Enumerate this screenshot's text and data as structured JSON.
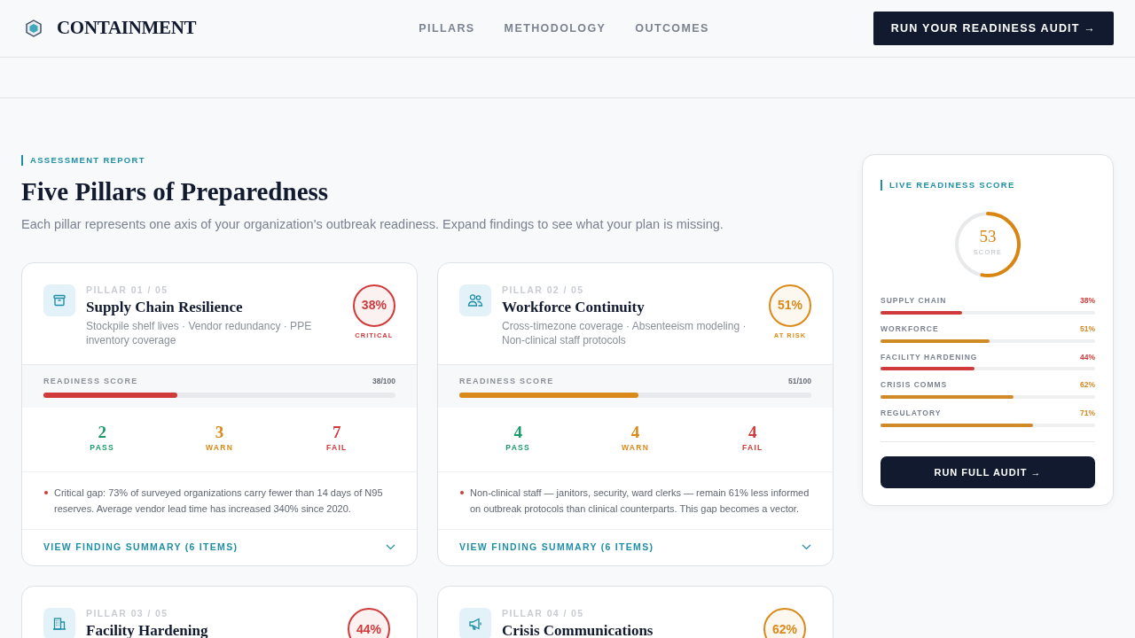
{
  "brand": {
    "name": "CONTAINMENT"
  },
  "nav": [
    {
      "label": "PILLARS"
    },
    {
      "label": "METHODOLOGY"
    },
    {
      "label": "OUTCOMES"
    }
  ],
  "cta": "RUN YOUR READINESS AUDIT →",
  "eyebrow": "ASSESSMENT REPORT",
  "title": "Five Pillars of Preparedness",
  "intro": "Each pillar represents one axis of your organization's outbreak readiness. Expand findings to see what your plan is missing.",
  "pillars": [
    {
      "number": "PILLAR 01 / 05",
      "title": "Supply Chain Resilience",
      "subtitle": "Stockpile shelf lives · Vendor redundancy · PPE inventory coverage",
      "percent": "38%",
      "color": "#d03a3a",
      "status_label": "CRITICAL",
      "score_label": "READINESS SCORE",
      "score_text": "38/100",
      "level": 0.38,
      "stats": [
        {
          "kind": "pass",
          "value": "2",
          "label": "PASS"
        },
        {
          "kind": "warn",
          "value": "3",
          "label": "WARN"
        },
        {
          "kind": "fail",
          "value": "7",
          "label": "FAIL"
        }
      ],
      "finding": "Critical gap: 73% of surveyed organizations carry fewer than 14 days of N95 reserves. Average vendor lead time has increased 340% since 2020.",
      "summary_link": "VIEW FINDING SUMMARY (6 ITEMS)"
    },
    {
      "number": "PILLAR 02 / 05",
      "title": "Workforce Continuity",
      "subtitle": "Cross-timezone coverage · Absenteeism modeling · Non-clinical staff protocols",
      "percent": "51%",
      "color": "#d98a1a",
      "status_label": "AT RISK",
      "score_label": "READINESS SCORE",
      "score_text": "51/100",
      "level": 0.51,
      "stats": [
        {
          "kind": "pass",
          "value": "4",
          "label": "PASS"
        },
        {
          "kind": "warn",
          "value": "4",
          "label": "WARN"
        },
        {
          "kind": "fail",
          "value": "4",
          "label": "FAIL"
        }
      ],
      "finding": "Non-clinical staff — janitors, security, ward clerks — remain 61% less informed on outbreak protocols than clinical counterparts. This gap becomes a vector.",
      "summary_link": "VIEW FINDING SUMMARY (6 ITEMS)"
    },
    {
      "number": "PILLAR 03 / 05",
      "title": "Facility Hardening",
      "percent": "44%",
      "color": "#d03a3a"
    },
    {
      "number": "PILLAR 04 / 05",
      "title": "Crisis Communications",
      "percent": "62%",
      "color": "#d98a1a"
    }
  ],
  "sidebar": {
    "eyebrow": "LIVE READINESS SCORE",
    "score": "53",
    "score_label": "SCORE",
    "level": 0.53,
    "items": [
      {
        "label": "SUPPLY CHAIN",
        "value": "38%",
        "level": 0.38,
        "color": "#d03a3a"
      },
      {
        "label": "WORKFORCE",
        "value": "51%",
        "level": 0.51,
        "color": "#d08a25"
      },
      {
        "label": "FACILITY HARDENING",
        "value": "44%",
        "level": 0.44,
        "color": "#d03a3a"
      },
      {
        "label": "CRISIS COMMS",
        "value": "62%",
        "level": 0.62,
        "color": "#d08a25"
      },
      {
        "label": "REGULATORY",
        "value": "71%",
        "level": 0.71,
        "color": "#d08a25"
      }
    ],
    "button": "RUN FULL AUDIT →"
  }
}
